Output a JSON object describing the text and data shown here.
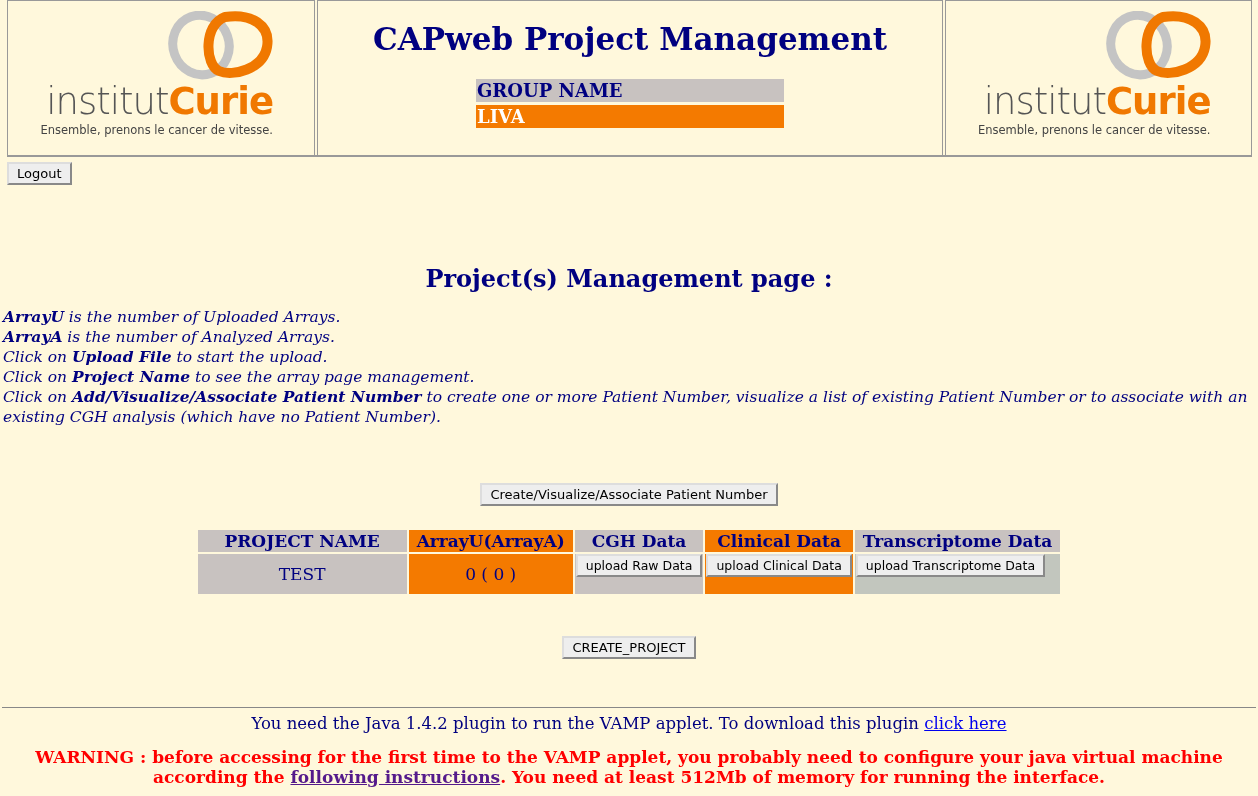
{
  "header": {
    "logos": [
      {
        "word1": "institut",
        "word2": "Curie",
        "tagline": "Ensemble, prenons le cancer de vitesse."
      },
      {
        "word1": "institut",
        "word2": "Curie",
        "tagline": "Ensemble, prenons le cancer de vitesse."
      }
    ],
    "title": "CAPweb Project Management",
    "group_label": "GROUP NAME",
    "group_name": "LIVA"
  },
  "logout_button": "Logout",
  "page_title": "Project(s) Management page :",
  "intro_lines": [
    "**ArrayU** is the number of Uploaded Arrays.",
    "**ArrayA** is the number of Analyzed Arrays.",
    "Click on **Upload File** to start the upload.",
    "Click on **Project Name** to see the array page management.",
    "Click on **Add/Visualize/Associate Patient Number** to create one or more Patient Number, visualize a list of existing Patient Number or to associate with an existing CGH analysis (which have no Patient Number)."
  ],
  "patient_button": "Create/Visualize/Associate Patient Number",
  "table": {
    "columns": [
      {
        "label": "PROJECT NAME",
        "color": "#c8c2c0"
      },
      {
        "label": "ArrayU(ArrayA)",
        "color": "#f47a00"
      },
      {
        "label": "CGH Data",
        "color": "#c8c2c0"
      },
      {
        "label": "Clinical Data",
        "color": "#f47a00"
      },
      {
        "label": "Transcriptome Data",
        "color": "#c8c2c0"
      }
    ],
    "rows": [
      {
        "cells": [
          {
            "kind": "link",
            "text": "TEST",
            "color": "#c8c2c0"
          },
          {
            "kind": "text",
            "text": "0 ( 0 )",
            "color": "#f47a00"
          },
          {
            "kind": "button",
            "text": "upload Raw Data",
            "color": "#c8c2c0"
          },
          {
            "kind": "button",
            "text": "upload Clinical Data",
            "color": "#f47a00"
          },
          {
            "kind": "button",
            "text": "upload Transcriptome Data",
            "color": "#c2c6be"
          }
        ]
      }
    ]
  },
  "create_button": "CREATE_PROJECT",
  "java_note": {
    "before": "You need the Java 1.4.2 plugin to run the VAMP applet. To download this plugin ",
    "link": "click here"
  },
  "warning": {
    "before": "WARNING : before accessing for the first time to the VAMP applet, you probably need to configure your java virtual machine according the ",
    "link": "following instructions",
    "after": ". You need at least 512Mb of memory for running the interface."
  }
}
